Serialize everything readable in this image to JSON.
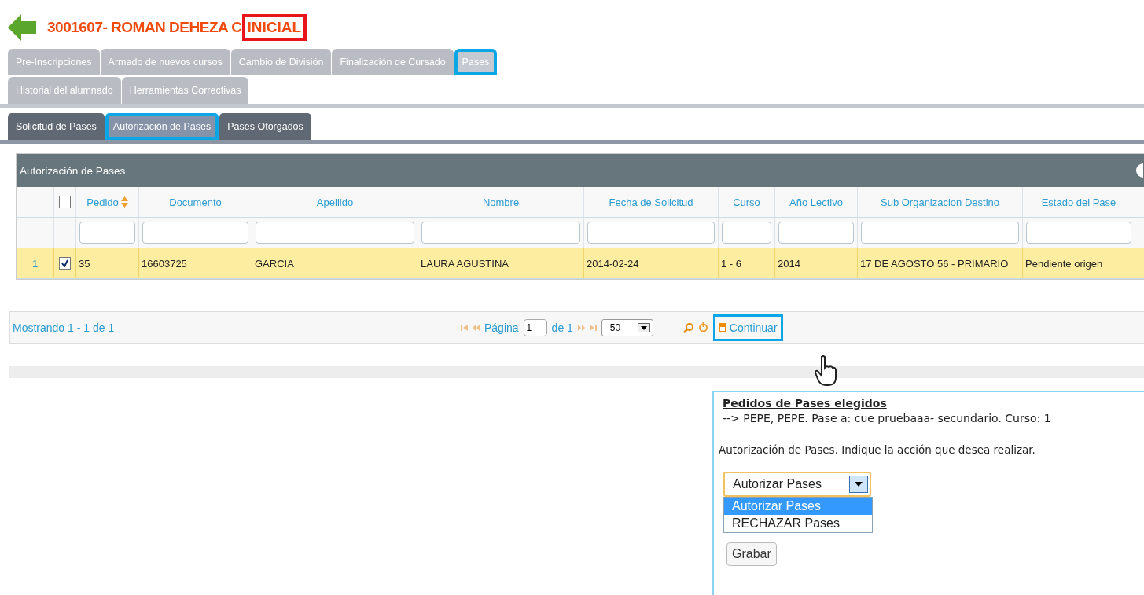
{
  "header": {
    "title": "3001607- ROMAN DEHEZA C",
    "badge": "INICIAL"
  },
  "main_tabs": [
    {
      "label": "Pre-Inscripciones",
      "selected": false,
      "highlighted": false
    },
    {
      "label": "Armado de nuevos cursos",
      "selected": false,
      "highlighted": false
    },
    {
      "label": "Cambio de División",
      "selected": false,
      "highlighted": false
    },
    {
      "label": "Finalización de Cursado",
      "selected": false,
      "highlighted": false
    },
    {
      "label": "Pases",
      "selected": true,
      "highlighted": true
    },
    {
      "label": "Historial del alumnado",
      "selected": false,
      "highlighted": false
    },
    {
      "label": "Herramientas Correctivas",
      "selected": false,
      "highlighted": false
    }
  ],
  "sub_tabs": [
    {
      "label": "Solicitud de Pases",
      "selected": false,
      "highlighted": false
    },
    {
      "label": "Autorización de Pases",
      "selected": true,
      "highlighted": true
    },
    {
      "label": "Pases Otorgados",
      "selected": false,
      "highlighted": false
    }
  ],
  "grid": {
    "title": "Autorización de Pases",
    "select_all_checked": false,
    "columns": [
      {
        "label": "Pedido",
        "sorted": true
      },
      {
        "label": "Documento",
        "sorted": false
      },
      {
        "label": "Apellido",
        "sorted": false
      },
      {
        "label": "Nombre",
        "sorted": false
      },
      {
        "label": "Fecha de Solicitud",
        "sorted": false
      },
      {
        "label": "Curso",
        "sorted": false
      },
      {
        "label": "Año Lectivo",
        "sorted": false
      },
      {
        "label": "Sub Organizacion Destino",
        "sorted": false
      },
      {
        "label": "Estado del Pase",
        "sorted": false
      }
    ],
    "rows": [
      {
        "number": "1",
        "checked": true,
        "selected": true,
        "cells": [
          "35",
          "16603725",
          "GARCIA",
          "LAURA AGUSTINA",
          "2014-02-24",
          "1 - 6",
          "2014",
          "17 DE AGOSTO 56 - PRIMARIO",
          "Pendiente origen"
        ]
      }
    ]
  },
  "pager": {
    "info": "Mostrando 1 - 1 de 1",
    "page_label": "Página",
    "page": "1",
    "of": "de 1",
    "page_size": "50",
    "continue": {
      "label": "Continuar",
      "highlighted": true
    }
  },
  "popup": {
    "title": "Pedidos de Pases elegidos",
    "line": "--> PEPE, PEPE. Pase a: cue pruebaaa- secundario. Curso: 1",
    "prompt": "Autorización de Pases. Indique la acción que desea realizar.",
    "select_value": "Autorizar Pases",
    "options": [
      {
        "label": "Autorizar Pases",
        "selected": true
      },
      {
        "label": "RECHAZAR Pases",
        "selected": false
      }
    ],
    "save": "Grabar"
  }
}
